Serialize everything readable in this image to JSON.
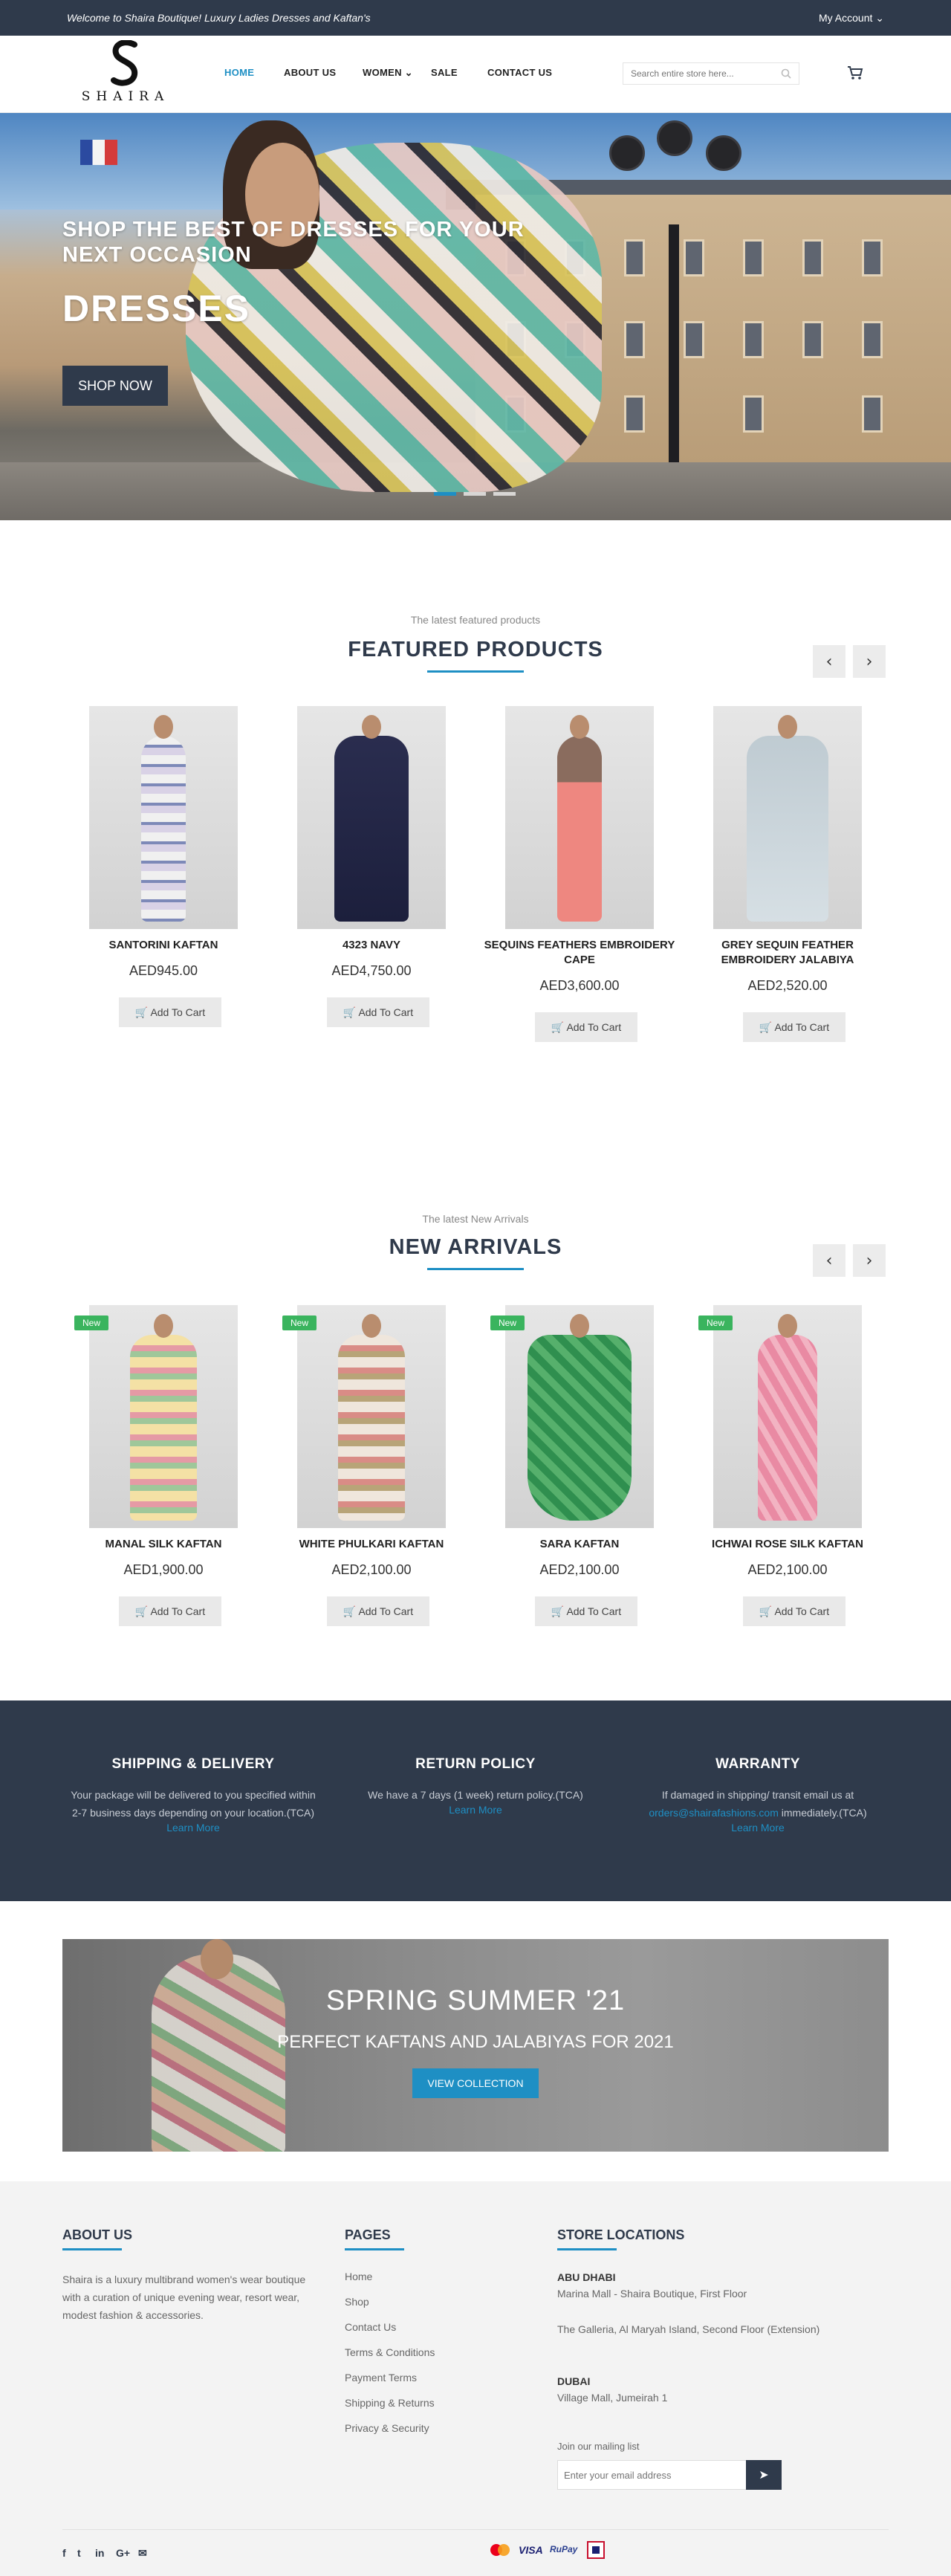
{
  "topbar": {
    "welcome": "Welcome to Shaira Boutique! Luxury Ladies Dresses and Kaftan's",
    "account": "My Account ⌄"
  },
  "brand": {
    "logo_text": "SHAIRA"
  },
  "nav": {
    "items": [
      {
        "label": "HOME"
      },
      {
        "label": "ABOUT US"
      },
      {
        "label": "WOMEN ⌄"
      },
      {
        "label": "SALE"
      },
      {
        "label": "CONTACT US"
      }
    ],
    "active": "HOME"
  },
  "search": {
    "placeholder": "Search entire store here..."
  },
  "hero": {
    "headline": "SHOP THE BEST OF DRESSES FOR YOUR NEXT OCCASION",
    "big": "DRESSES",
    "button": "SHOP NOW",
    "slides": 3,
    "active_slide": 1
  },
  "featured": {
    "subtitle": "The latest featured products",
    "title": "FEATURED PRODUCTS",
    "prev": "‹",
    "next": "›",
    "add_label": "Add To Cart",
    "products": [
      {
        "name": "SANTORINI KAFTAN",
        "price": "AED945.00"
      },
      {
        "name": "4323 NAVY",
        "price": "AED4,750.00"
      },
      {
        "name": "SEQUINS FEATHERS EMBROIDERY CAPE",
        "price": "AED3,600.00"
      },
      {
        "name": "GREY SEQUIN FEATHER EMBROIDERY JALABIYA",
        "price": "AED2,520.00"
      }
    ]
  },
  "arrivals": {
    "subtitle": "The latest New Arrivals",
    "title": "NEW ARRIVALS",
    "prev": "‹",
    "next": "›",
    "badge": "New",
    "add_label": "Add To Cart",
    "products": [
      {
        "name": "MANAL SILK KAFTAN",
        "price": "AED1,900.00"
      },
      {
        "name": "WHITE PHULKARI KAFTAN",
        "price": "AED2,100.00"
      },
      {
        "name": "SARA KAFTAN",
        "price": "AED2,100.00"
      },
      {
        "name": "ICHWAI ROSE SILK KAFTAN",
        "price": "AED2,100.00"
      }
    ]
  },
  "info": {
    "shipping": {
      "title": "SHIPPING & DELIVERY",
      "text": "Your package will be delivered to you specified within 2-7 business days depending on your location.(TCA)",
      "link": "Learn More"
    },
    "returns": {
      "title": "RETURN POLICY",
      "text": "We have a 7 days (1 week) return policy.(TCA)",
      "link": "Learn More"
    },
    "warranty": {
      "title": "WARRANTY",
      "text_before": "If damaged in shipping/ transit email us at",
      "email": "orders@shairafashions.com",
      "text_after": "immediately.(TCA)",
      "link": "Learn More"
    }
  },
  "promo": {
    "title": "SPRING SUMMER '21",
    "subtitle": "PERFECT KAFTANS AND JALABIYAS FOR 2021",
    "button": "VIEW COLLECTION"
  },
  "footer": {
    "about_title": "ABOUT US",
    "about_text": "Shaira is a luxury multibrand women's wear boutique with a curation of unique evening wear, resort wear, modest fashion & accessories.",
    "pages_title": "PAGES",
    "pages": [
      "Home",
      "Shop",
      "Contact Us",
      "Terms & Conditions",
      "Payment Terms",
      "Shipping & Returns",
      "Privacy & Security"
    ],
    "stores_title": "STORE LOCATIONS",
    "abu_dhabi": {
      "city": "ABU DHABI",
      "loc1": "Marina Mall - Shaira Boutique, First Floor",
      "loc2": "The Galleria, Al Maryah Island, Second Floor (Extension)"
    },
    "dubai": {
      "city": "DUBAI",
      "loc1": "Village Mall, Jumeirah 1"
    },
    "mailing_label": "Join our mailing list",
    "mailing_placeholder": "Enter your email address",
    "send": "➤",
    "social": [
      "f",
      "t",
      "in",
      "G+",
      "✉"
    ],
    "payments": [
      "VISA",
      "RuPay"
    ]
  },
  "colors": {
    "navy": "#2f3a4b",
    "accent": "#1e8fc4",
    "badge": "#3ab45e"
  }
}
